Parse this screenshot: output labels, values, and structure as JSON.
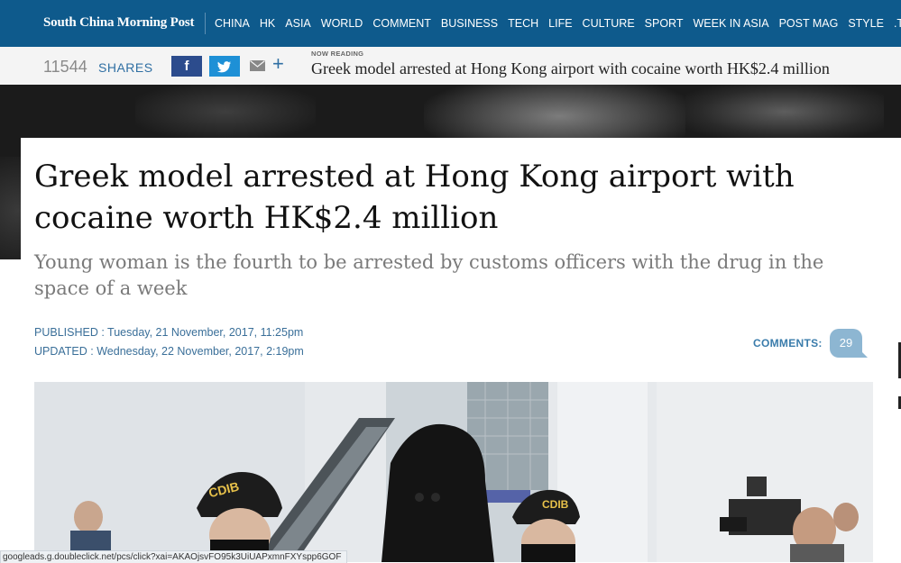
{
  "site": {
    "logo": "South China Morning Post",
    "nav": [
      "CHINA",
      "HK",
      "ASIA",
      "WORLD",
      "COMMENT",
      "BUSINESS",
      "TECH",
      "LIFE",
      "CULTURE",
      "SPORT",
      "WEEK IN ASIA",
      "POST MAG",
      "STYLE",
      ".TV"
    ]
  },
  "sharebar": {
    "count": "11544",
    "label": "SHARES",
    "facebook_icon": "f",
    "now_reading_label": "NOW READING",
    "now_reading_title": "Greek model arrested at Hong Kong airport with cocaine worth HK$2.4 million"
  },
  "article": {
    "headline": "Greek model arrested at Hong Kong airport with cocaine worth HK$2.4 million",
    "subhead": "Young woman is the fourth to be arrested by customs officers with the drug in the space of a week",
    "published": "PUBLISHED : Tuesday, 21 November, 2017, 11:25pm",
    "updated": "UPDATED : Wednesday, 22 November, 2017, 2:19pm",
    "comments_label": "COMMENTS:",
    "comments_count": "29",
    "cap_badge_left": "CDIB",
    "cap_badge_right": "CDIB"
  },
  "statusbar": {
    "url": "googleads.g.doubleclick.net/pcs/click?xai=AKAOjsvFO95k3UiUAPxmnFXYspp6GOF"
  },
  "colors": {
    "nav_bg": "#0e5a8c",
    "accent_blue": "#3a6f99",
    "comment_bubble": "#8db6d2"
  }
}
